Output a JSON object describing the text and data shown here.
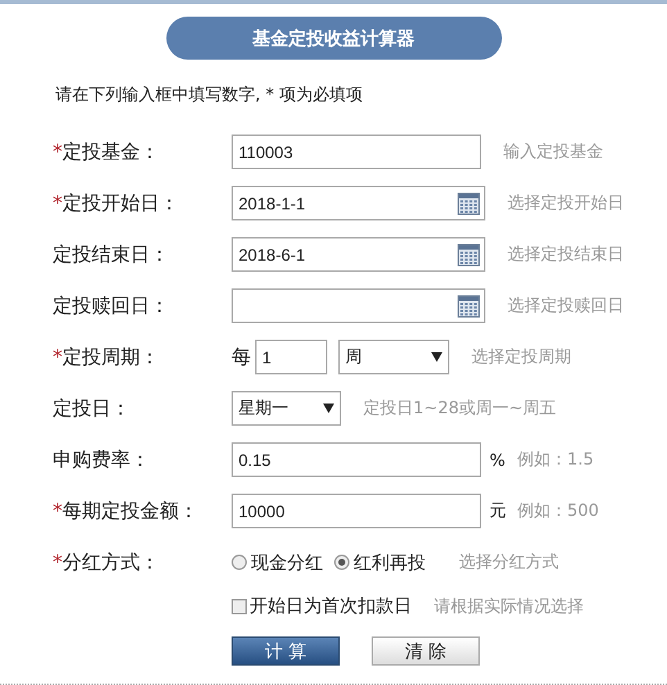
{
  "title": "基金定投收益计算器",
  "instruction": "请在下列输入框中填写数字, * 项为必填项",
  "rows": [
    {
      "kind": "text",
      "marker": "*",
      "label": "定投基金：",
      "value": "110003",
      "hint": "输入定投基金"
    },
    {
      "kind": "date",
      "marker": "*",
      "label": "定投开始日：",
      "value": "2018-1-1",
      "hint": "选择定投开始日"
    },
    {
      "kind": "date",
      "label": "定投结束日：",
      "value": "2018-6-1",
      "hint": "选择定投结束日"
    },
    {
      "kind": "date",
      "label": "定投赎回日：",
      "hint": "选择定投赎回日"
    },
    {
      "kind": "period",
      "marker": "*",
      "label": "定投周期：",
      "prefix": "每",
      "value": "1",
      "unit_select": "周",
      "hint": "选择定投周期"
    },
    {
      "kind": "select",
      "label": "定投日：",
      "value": "星期一",
      "hint": "定投日1~28或周一~周五"
    },
    {
      "kind": "text",
      "label": "申购费率：",
      "value": "0.15",
      "unit": "%",
      "hint": "例如：1.5"
    },
    {
      "kind": "text",
      "marker": "*",
      "label": "每期定投金额：",
      "value": "10000",
      "unit": "元",
      "hint": "例如：500"
    },
    {
      "kind": "radio",
      "marker": "*",
      "label": "分红方式：",
      "options": [
        {
          "label": "现金分红",
          "selected": false
        },
        {
          "label": "红利再投",
          "selected": true
        }
      ],
      "hint": "选择分红方式"
    },
    {
      "kind": "checkbox",
      "text": "开始日为首次扣款日",
      "checked": false,
      "hint": "请根据实际情况选择"
    }
  ],
  "buttons": [
    {
      "label": "计 算",
      "kind": "primary"
    },
    {
      "label": "清 除",
      "kind": "secondary"
    }
  ]
}
